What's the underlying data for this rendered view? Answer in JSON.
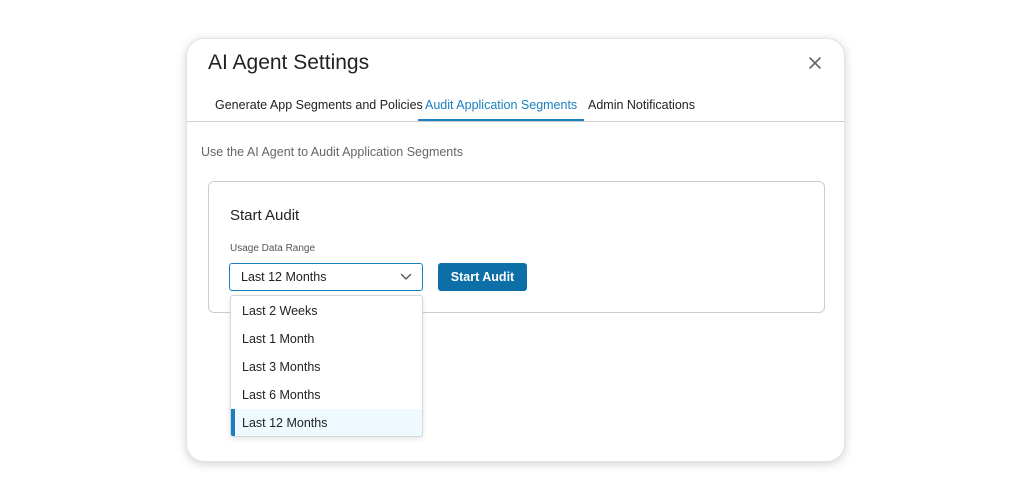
{
  "modal": {
    "title": "AI Agent Settings",
    "close_icon": "close-icon"
  },
  "tabs": [
    {
      "label": "Generate App Segments and Policies",
      "active": false
    },
    {
      "label": "Audit Application Segments",
      "active": true
    },
    {
      "label": "Admin Notifications",
      "active": false
    }
  ],
  "description": "Use the AI Agent to Audit Application Segments",
  "audit_card": {
    "title": "Start Audit",
    "field_label": "Usage Data Range",
    "selected_value": "Last 12 Months",
    "button_label": "Start Audit",
    "chevron_icon": "chevron-down-icon"
  },
  "dropdown": {
    "options": [
      "Last 2 Weeks",
      "Last 1 Month",
      "Last 3 Months",
      "Last 6 Months",
      "Last 12 Months"
    ],
    "selected_index": 4
  },
  "colors": {
    "accent": "#1a7fc0",
    "primary_button": "#0d6fa8",
    "selected_option_bg": "#eefaff"
  }
}
